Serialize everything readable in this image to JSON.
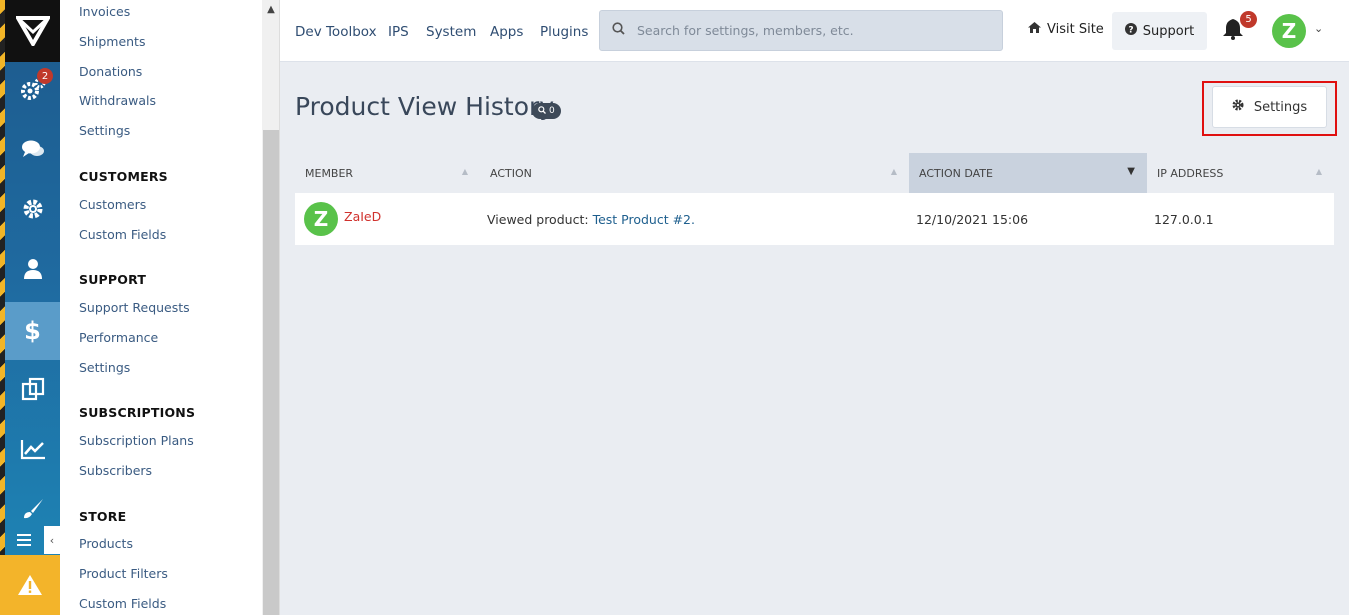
{
  "subnav": {
    "top_links": [
      "Invoices",
      "Shipments",
      "Donations",
      "Withdrawals",
      "Settings"
    ],
    "sections": [
      {
        "heading": "CUSTOMERS",
        "links": [
          "Customers",
          "Custom Fields"
        ]
      },
      {
        "heading": "SUPPORT",
        "links": [
          "Support Requests",
          "Performance",
          "Settings"
        ]
      },
      {
        "heading": "SUBSCRIPTIONS",
        "links": [
          "Subscription Plans",
          "Subscribers"
        ]
      },
      {
        "heading": "STORE",
        "links": [
          "Products",
          "Product Filters",
          "Custom Fields"
        ]
      }
    ]
  },
  "rail": {
    "items": [
      "settings-gears-icon",
      "chat-icon",
      "gear-icon",
      "user-icon",
      "dollar-icon",
      "pages-icon",
      "chart-icon",
      "brush-icon"
    ],
    "badge": "2",
    "active": "dollar-icon"
  },
  "topbar": {
    "nav": [
      "Dev Toolbox",
      "IPS",
      "System",
      "Apps",
      "Plugins"
    ],
    "search_placeholder": "Search for settings, members, etc.",
    "visit_site": "Visit Site",
    "support": "Support",
    "notification_count": "5",
    "avatar_letter": "Z"
  },
  "page": {
    "title": "Product View History",
    "count": "0",
    "settings_button": "Settings"
  },
  "table": {
    "columns": [
      "MEMBER",
      "ACTION",
      "ACTION DATE",
      "IP ADDRESS"
    ],
    "sorted_column": "ACTION DATE",
    "rows": [
      {
        "avatar": "Z",
        "member": "ZaIeD",
        "action_prefix": "Viewed product:",
        "action_link": "Test Product #2.",
        "date": "12/10/2021 15:06",
        "ip": "127.0.0.1"
      }
    ]
  },
  "colors": {
    "accent": "#1d5a8c",
    "highlight": "#e01010",
    "avatar": "#59c24a",
    "badge": "#c0392b"
  }
}
